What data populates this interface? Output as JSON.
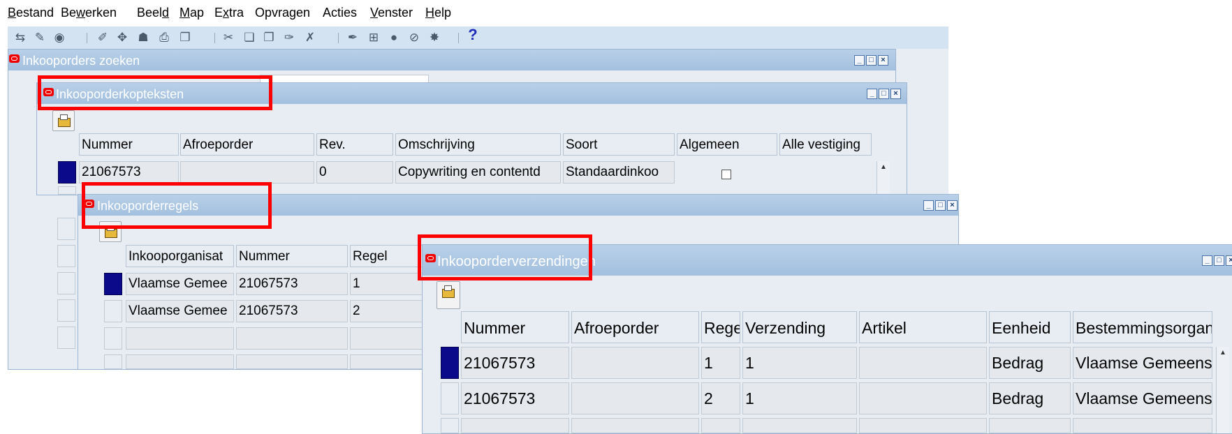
{
  "menu": [
    {
      "label": "Bestand",
      "accel": "B",
      "rest": "estand"
    },
    {
      "label": "Bewerken",
      "pre": "Be",
      "accel": "w",
      "rest": "erken"
    },
    {
      "label": "Beeld",
      "pre": "Beel",
      "accel": "d",
      "rest": ""
    },
    {
      "label": "Map",
      "accel": "M",
      "rest": "ap"
    },
    {
      "label": "Extra",
      "pre": "E",
      "accel": "x",
      "rest": "tra"
    },
    {
      "label": "Opvragen"
    },
    {
      "label": "Acties"
    },
    {
      "label": "Venster",
      "accel": "V",
      "rest": "enster"
    },
    {
      "label": "Help",
      "accel": "H",
      "rest": "elp"
    }
  ],
  "toolbar": {
    "icons": [
      "new-icon",
      "flashlight-icon",
      "navigate-icon",
      "edit-icon",
      "zoom-icon",
      "binoculars-icon",
      "print-icon",
      "attachments-icon",
      "cut-icon",
      "copy-icon",
      "paste-icon",
      "clear-record-icon",
      "delete-icon",
      "edit-field-icon",
      "translate-icon",
      "folder-icon",
      "attach-icon",
      "zoom-custom-icon"
    ],
    "help_glyph": "?"
  },
  "windows": {
    "search": {
      "title": "Inkooporders zoeken"
    },
    "headers": {
      "title": "Inkooporderkopteksten",
      "columns": [
        "Nummer",
        "Afroeporder",
        "Rev.",
        "Omschrijving",
        "Soort",
        "Algemeen",
        "Alle vestiging"
      ],
      "rows": [
        {
          "nummer": "21067573",
          "afroeporder": "",
          "rev": "0",
          "omschrijving": "Copywriting en contentd",
          "soort": "Standaardinkoo"
        }
      ]
    },
    "lines": {
      "title": "Inkooporderregels",
      "columns": [
        "Inkooporganisat",
        "Nummer",
        "Regel"
      ],
      "rows": [
        {
          "org": "Vlaamse Gemee",
          "nummer": "21067573",
          "regel": "1"
        },
        {
          "org": "Vlaamse Gemee",
          "nummer": "21067573",
          "regel": "2"
        }
      ]
    },
    "shipments": {
      "title": "Inkooporderverzendingen",
      "columns": [
        "Nummer",
        "Afroeporder",
        "Regel",
        "Verzending",
        "Artikel",
        "Eenheid",
        "Bestemmingsorganisat"
      ],
      "rows": [
        {
          "nummer": "21067573",
          "afroeporder": "",
          "regel": "1",
          "verzending": "1",
          "artikel": "",
          "eenheid": "Bedrag",
          "bestemming": "Vlaamse Gemeenscha"
        },
        {
          "nummer": "21067573",
          "afroeporder": "",
          "regel": "2",
          "verzending": "1",
          "artikel": "",
          "eenheid": "Bedrag",
          "bestemming": "Vlaamse Gemeenscha"
        }
      ]
    }
  },
  "colors": {
    "highlight": "#ff0000",
    "selected_row": "#0a0a8a",
    "titlebar": "#a3c0df"
  }
}
